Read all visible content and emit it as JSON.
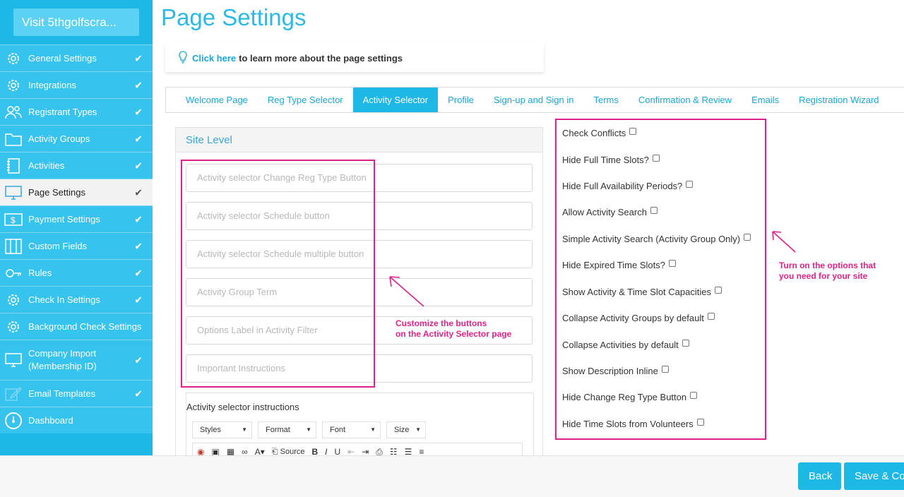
{
  "sidebar": {
    "visit_label": "Visit 5thgolfscra...",
    "items": [
      {
        "label": "General Settings",
        "icon": "gear-icon"
      },
      {
        "label": "Integrations",
        "icon": "gear-icon"
      },
      {
        "label": "Registrant Types",
        "icon": "users-icon"
      },
      {
        "label": "Activity Groups",
        "icon": "folder-icon"
      },
      {
        "label": "Activities",
        "icon": "notebook-icon"
      },
      {
        "label": "Page Settings",
        "icon": "monitor-icon"
      },
      {
        "label": "Payment Settings",
        "icon": "money-icon"
      },
      {
        "label": "Custom Fields",
        "icon": "columns-icon"
      },
      {
        "label": "Rules",
        "icon": "key-icon"
      },
      {
        "label": "Check In Settings",
        "icon": "gear-icon"
      },
      {
        "label": "Background Check Settings",
        "icon": "gear-icon"
      },
      {
        "label": "Company Import\n(Membership ID)",
        "icon": "monitor-icon"
      },
      {
        "label": "Email Templates",
        "icon": "edit-icon"
      },
      {
        "label": "Dashboard",
        "icon": "gauge-icon"
      }
    ]
  },
  "header": {
    "title": "Page Settings",
    "tip_link": "Click here",
    "tip_text": "to learn more about the page settings"
  },
  "tabs": [
    "Welcome Page",
    "Reg Type Selector",
    "Activity Selector",
    "Profile",
    "Sign-up and Sign in",
    "Terms",
    "Confirmation & Review",
    "Emails",
    "Registration Wizard"
  ],
  "panel": {
    "title": "Site Level",
    "fields": [
      "Activity selector Change Reg Type Button",
      "Activity selector Schedule button",
      "Activity selector Schedule multiple button",
      "Activity Group Term",
      "Options Label in Activity Filter",
      "Important Instructions"
    ],
    "editor_label": "Activity selector instructions",
    "dropdowns": [
      "Styles",
      "Format",
      "Font",
      "Size"
    ],
    "source_label": "Source"
  },
  "annotations": {
    "left": "Customize the buttons\non the Activity Selector page",
    "right": "Turn on the options that\nyou need for your site"
  },
  "options": [
    "Check Conflicts",
    "Hide Full Time Slots?",
    "Hide Full Availability Periods?",
    "Allow Activity Search",
    "Simple Activity Search (Activity Group Only)",
    "Hide Expired Time Slots?",
    "Show Activity & Time Slot Capacities",
    "Collapse Activity Groups by default",
    "Collapse Activities by default",
    "Show Description Inline",
    "Hide Change Reg Type Button",
    "Hide Time Slots from Volunteers"
  ],
  "footer": {
    "back_label": "Back",
    "save_label": "Save & Co"
  },
  "colors": {
    "brand": "#1eb8e6",
    "highlight": "#e0218a"
  }
}
